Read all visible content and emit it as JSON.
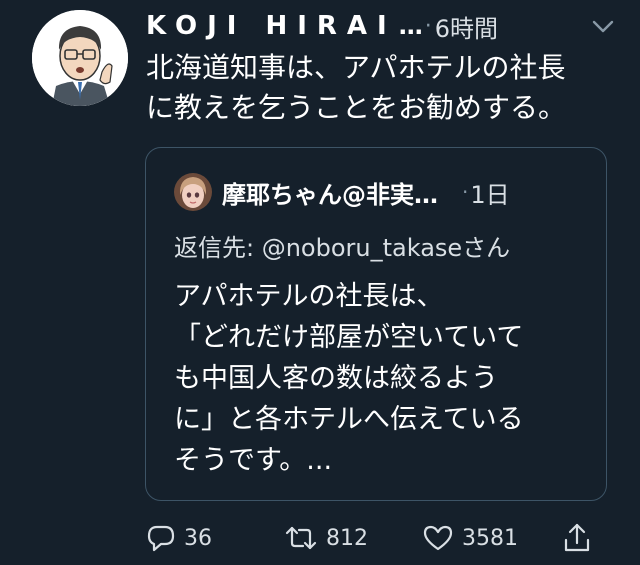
{
  "tweet": {
    "author_name": "KOJI HIRAI",
    "author_ellipsis": "…",
    "separator": "·",
    "time": "6時間",
    "text_lines": [
      "北海道知事は、アパホテルの社長",
      "に教えを乞うことをお勧めする。"
    ]
  },
  "quote": {
    "author_name": "摩耶ちゃん@非実…",
    "separator": "·",
    "time": "1日",
    "reply_to": "返信先: @noboru_takaseさん",
    "text_lines": [
      "アパホテルの社長は、",
      "「どれだけ部屋が空いていて",
      "も中国人客の数は絞るよう",
      "に」と各ホテルへ伝えている",
      "そうです。..."
    ]
  },
  "actions": {
    "reply_count": "36",
    "retweet_count": "812",
    "like_count": "3581"
  },
  "icons": {
    "menu": "chevron-down-icon",
    "reply": "reply-icon",
    "retweet": "retweet-icon",
    "like": "heart-icon",
    "share": "share-icon"
  },
  "colors": {
    "background": "#15202b",
    "secondary_text": "#8899a6",
    "card_border": "#3d5466"
  }
}
